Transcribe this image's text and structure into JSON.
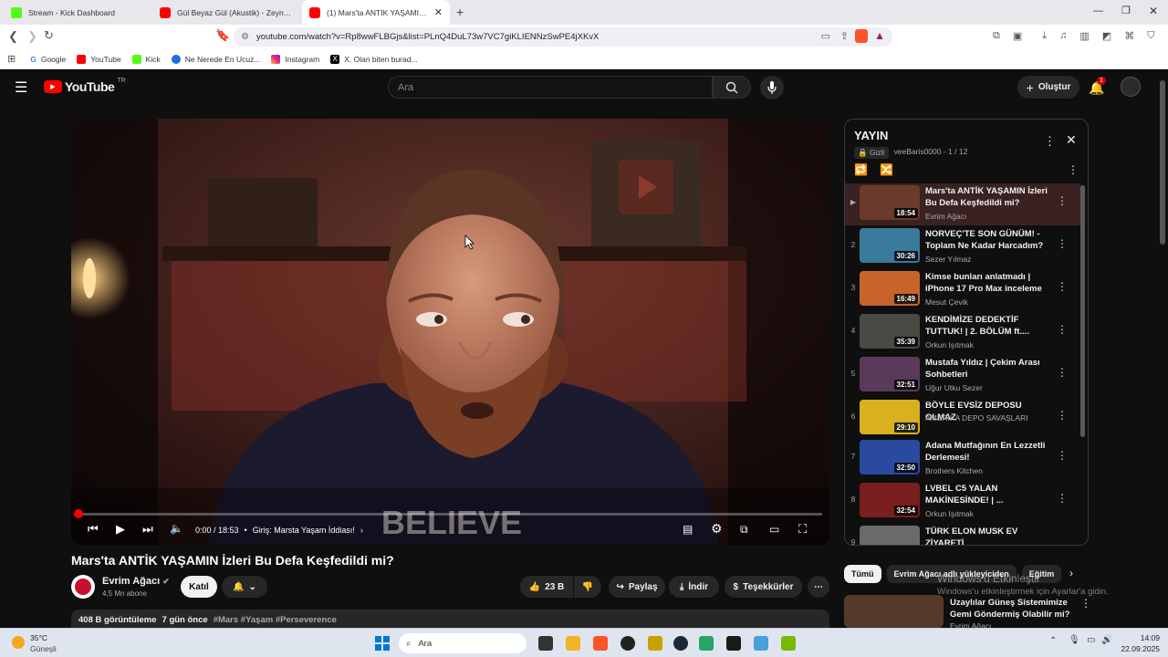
{
  "browser": {
    "tabs": [
      {
        "title": "Stream - Kick Dashboard",
        "icon": "kick-icon",
        "color": "#53fc18"
      },
      {
        "title": "Gül Beyaz Gül (Akustik) - Zeynep...",
        "icon": "youtube-icon",
        "color": "#ff0000"
      },
      {
        "title": "(1) Mars'ta ANTİK YAŞAMIN İzle...",
        "icon": "youtube-icon",
        "color": "#ff0000"
      }
    ],
    "url": "youtube.com/watch?v=Rp8wwFLBGjs&list=PLnQ4DuL73w7VC7giKLIENNzSwPE4jXKvX",
    "bookmarks": [
      "Google",
      "YouTube",
      "Kick",
      "Ne Nerede En Ucuz...",
      "Instagram",
      "X. Olan biten burad..."
    ]
  },
  "youtube": {
    "logo": "YouTube",
    "region": "TR",
    "search_placeholder": "Ara",
    "create_label": "Oluştur",
    "notification_count": "1",
    "video": {
      "title": "Mars'ta ANTİK YAŞAMIN İzleri Bu Defa Keşfedildi mi?",
      "time": "0:00 / 18:53",
      "chapter": "Giriş: Marsta Yaşam İddiası!",
      "progress": 0.0,
      "shirt_text": "BELIEVE"
    },
    "channel": {
      "name": "Evrim Ağacı",
      "subs": "4,5 Mn abone",
      "join_label": "Katıl"
    },
    "actions": {
      "likes": "23 B",
      "share": "Paylaş",
      "download": "İndir",
      "thanks": "Teşekkürler"
    },
    "description": {
      "views": "408 B görüntüleme",
      "date": "7 gün önce",
      "tags": "#Mars #Yaşam #Perseverence"
    },
    "playlist": {
      "title": "YAYIN",
      "privacy": "Gizli",
      "owner_pos": "veeBaris0000 - 1 / 12",
      "items": [
        {
          "num": "▶",
          "title": "Mars'ta ANTİK YAŞAMIN İzleri Bu Defa Keşfedildi mi?",
          "channel": "Evrim Ağacı",
          "duration": "18:54",
          "thumb": "#6b3a2a"
        },
        {
          "num": "2",
          "title": "NORVEÇ'TE SON GÜNÜM! - Toplam Ne Kadar Harcadım?",
          "channel": "Sezer Yılmaz",
          "duration": "30:26",
          "thumb": "#3a7a9a"
        },
        {
          "num": "3",
          "title": "Kimse bunları anlatmadı | iPhone 17 Pro Max inceleme",
          "channel": "Mesut Çevik",
          "duration": "16:49",
          "thumb": "#c8642a"
        },
        {
          "num": "4",
          "title": "KENDİMİZE DEDEKTİF TUTTUK! | 2. BÖLÜM ft....",
          "channel": "Orkun Işıtmak",
          "duration": "35:39",
          "thumb": "#4a4a44"
        },
        {
          "num": "5",
          "title": "Mustafa Yıldız | Çekim Arası Sohbetleri",
          "channel": "Uğur Utku Sezer",
          "duration": "32:51",
          "thumb": "#5a3a5a"
        },
        {
          "num": "6",
          "title": "BÖYLE EVSİZ DEPOSU OLMAZ",
          "channel": "AMERİKA DEPO SAVAŞLARI",
          "duration": "29:10",
          "thumb": "#d8b020"
        },
        {
          "num": "7",
          "title": "Adana Mutfağının En Lezzetli Derlemesi!",
          "channel": "Brothers Kitchen",
          "duration": "32:50",
          "thumb": "#2a4aa0"
        },
        {
          "num": "8",
          "title": "LVBEL C5 YALAN MAKİNESİNDE! | ...",
          "channel": "Orkun Işıtmak",
          "duration": "32:54",
          "thumb": "#7a1e1e"
        },
        {
          "num": "9",
          "title": "TÜRK ELON MUSK EV ZİYARETİ",
          "channel": "",
          "duration": "",
          "thumb": "#6a6a6a"
        }
      ]
    },
    "filters": [
      "Tümü",
      "Evrim Ağacı adlı yükleyiciden",
      "Eğitim"
    ],
    "suggested": {
      "title": "Uzaylılar Güneş Sistemimize Gemi Göndermiş Olabilir mi?",
      "channel": "Evrim Ağacı"
    },
    "watermark": {
      "line1": "Windows'u Etkinleştir",
      "line2": "Windows'u etkinleştirmek için Ayarlar'a gidin."
    }
  },
  "taskbar": {
    "temp": "35°C",
    "weather": "Güneşli",
    "search": "Ara",
    "time": "14:09",
    "date": "22.09.2025"
  }
}
